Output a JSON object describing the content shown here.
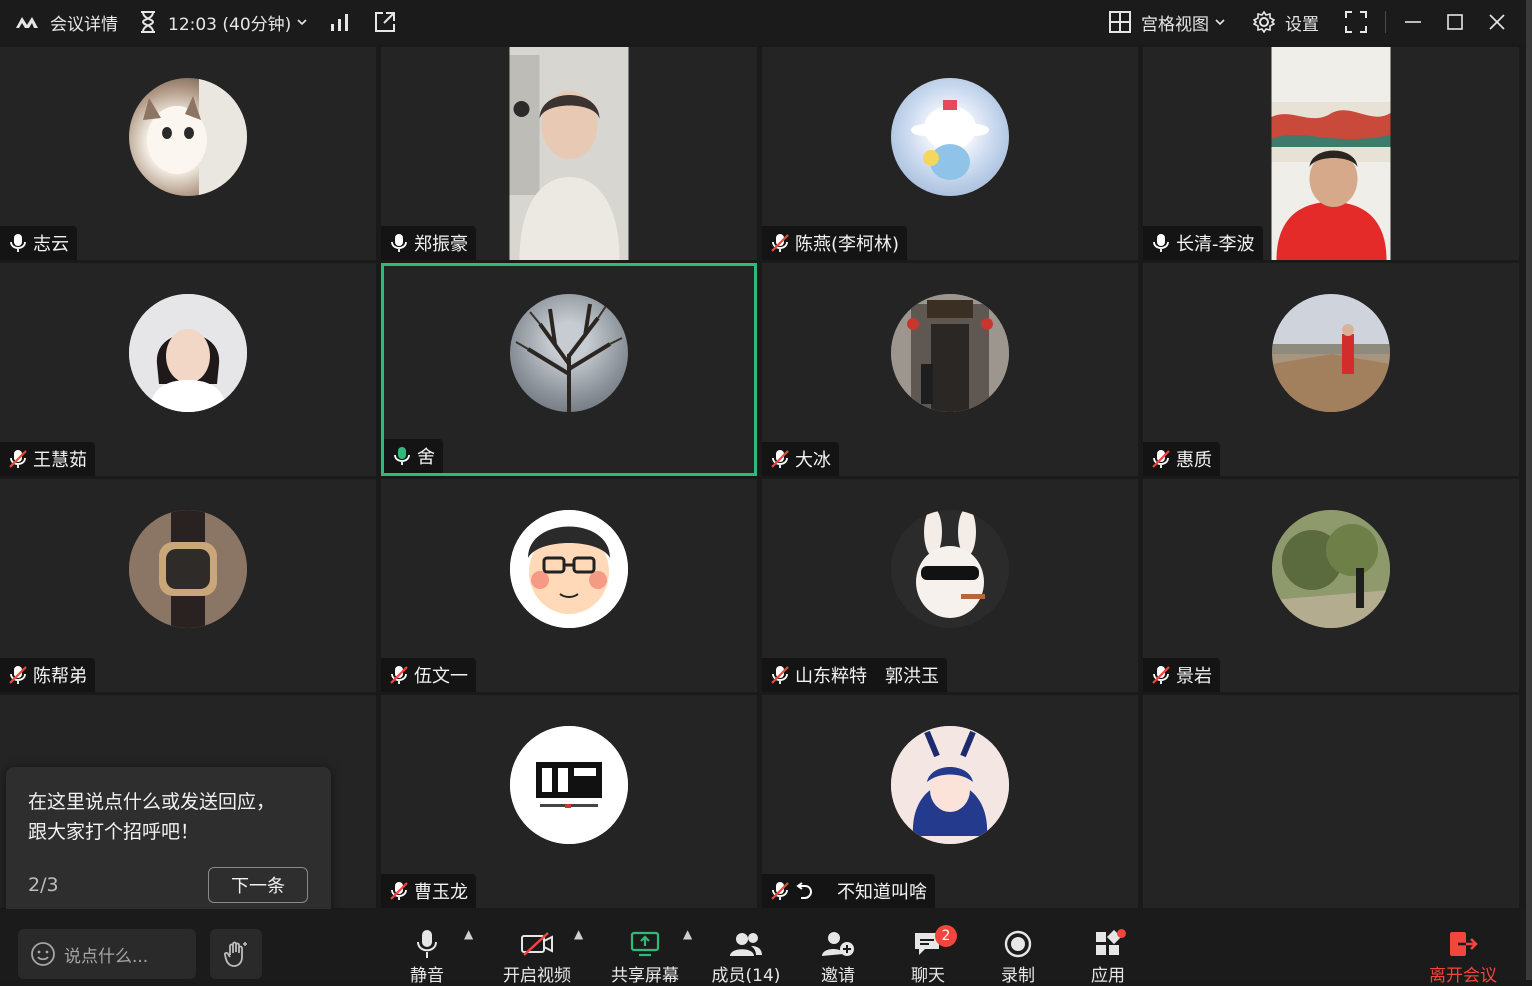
{
  "topbar": {
    "meeting_details": "会议详情",
    "duration": "12:03 (40分钟)",
    "view_mode": "宫格视图",
    "settings": "设置"
  },
  "participants": [
    {
      "name": "志云",
      "mic": "on",
      "avatar": "cat-photo"
    },
    {
      "name": "郑振豪",
      "mic": "on",
      "avatar": "video-woman"
    },
    {
      "name": "陈燕(李柯林)",
      "mic": "muted",
      "avatar": "cartoon-toy"
    },
    {
      "name": "长清-李波",
      "mic": "on",
      "avatar": "video-man"
    },
    {
      "name": "王慧茹",
      "mic": "muted",
      "avatar": "woman-portrait"
    },
    {
      "name": "舍",
      "mic": "speaking",
      "avatar": "tree-photo"
    },
    {
      "name": "大冰",
      "mic": "muted",
      "avatar": "building-photo"
    },
    {
      "name": "惠质",
      "mic": "muted",
      "avatar": "great-wall-photo"
    },
    {
      "name": "陈帮弟",
      "mic": "muted",
      "avatar": "watch-photo"
    },
    {
      "name": "伍文一",
      "mic": "muted",
      "avatar": "cartoon-face"
    },
    {
      "name": "山东粹特　郭洪玉",
      "mic": "muted",
      "avatar": "rabbit-sunglasses"
    },
    {
      "name": "景岩",
      "mic": "muted",
      "avatar": "forest-photo"
    },
    {
      "name": "曹玉龙",
      "mic": "muted",
      "avatar": "logo-white"
    },
    {
      "name": "不知道叫啥",
      "mic": "muted",
      "avatar": "anime-girl"
    }
  ],
  "tip": {
    "text_line1": "在这里说点什么或发送回应，",
    "text_line2": "跟大家打个招呼吧！",
    "count": "2/3",
    "next_label": "下一条"
  },
  "bottombar": {
    "chat_placeholder": "说点什么...",
    "mute_label": "静音",
    "video_label": "开启视频",
    "share_label": "共享屏幕",
    "members_label": "成员(14)",
    "invite_label": "邀请",
    "chat_label": "聊天",
    "chat_badge": "2",
    "record_label": "录制",
    "apps_label": "应用",
    "leave_label": "离开会议"
  },
  "colors": {
    "accent_green": "#2ebb7a",
    "leave_red": "#f2453d",
    "tile_bg": "#242424"
  }
}
